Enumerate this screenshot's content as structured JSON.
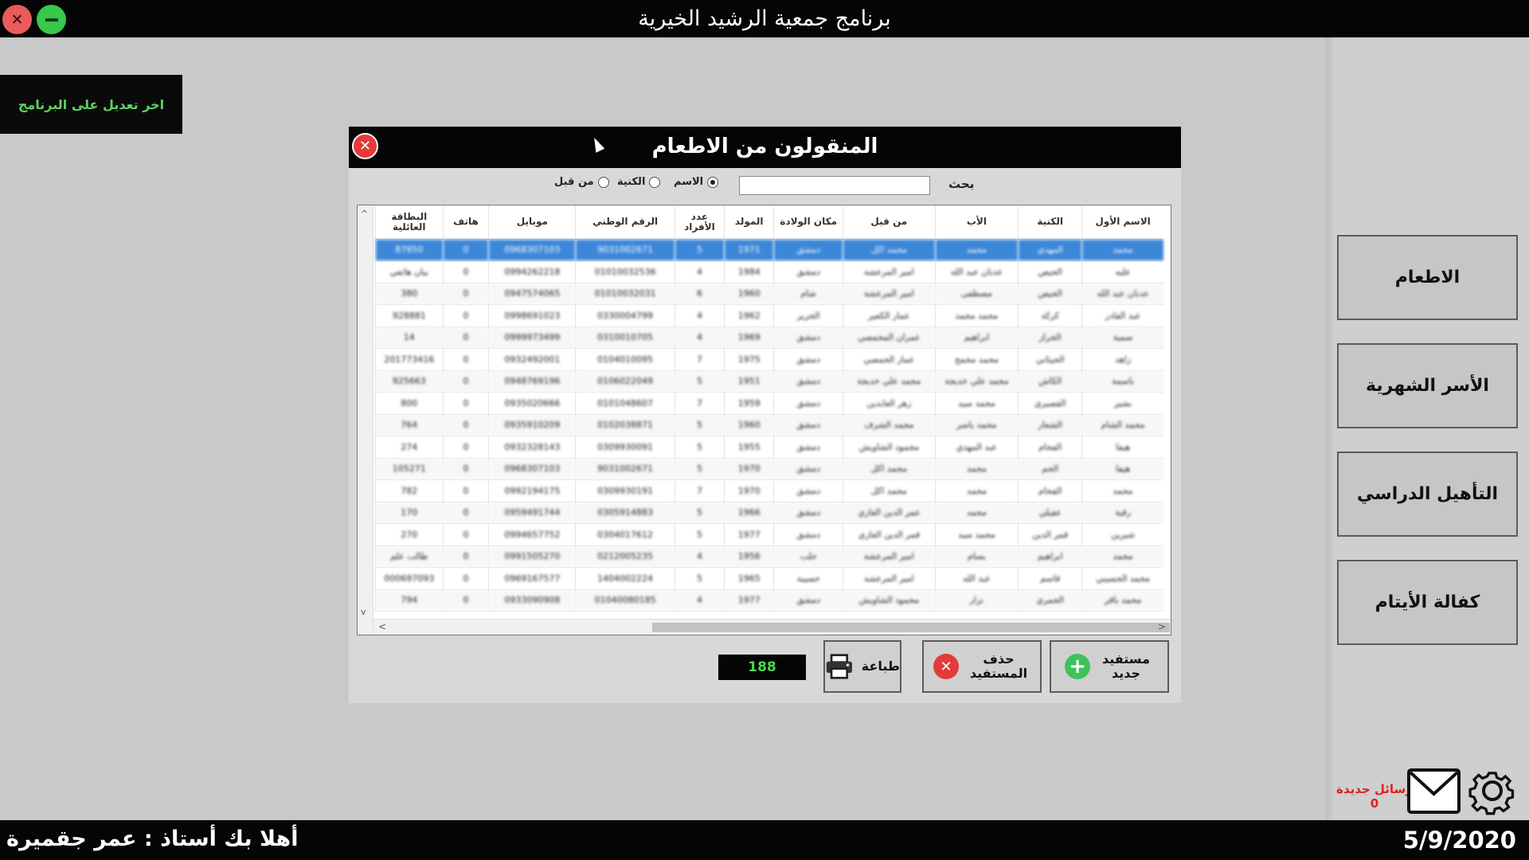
{
  "app": {
    "title": "برنامج جمعية الرشيد الخيرية"
  },
  "last_edit_label": "اخر تعديل على البرنامج",
  "side_buttons": [
    "الاطعام",
    "الأسر الشهرية",
    "التأهيل الدراسي",
    "كفالة الأيتام"
  ],
  "messages": {
    "label": "رسائل جديدة",
    "count": "0"
  },
  "status": {
    "welcome": "أهلا بك أستاذ : عمر جقميرة",
    "date": "5/9/2020"
  },
  "dialog": {
    "title": "المنقولون من الاطعام",
    "search_label": "بحث",
    "search_value": "",
    "radios": [
      {
        "label": "الاسم",
        "selected": true
      },
      {
        "label": "الكنية",
        "selected": false
      },
      {
        "label": "من قبل",
        "selected": false
      }
    ],
    "columns": [
      "الاسم الأول",
      "الكنية",
      "الأب",
      "من قبل",
      "مكان الولادة",
      "المولد",
      "عدد الأفراد",
      "الرقم الوطني",
      "موبايل",
      "هاتف",
      "البطاقة العائلية"
    ],
    "rows": [
      [
        "محمد",
        "المهدي",
        "محمد",
        "محمد اكل",
        "دمشق",
        "1971",
        "5",
        "9031002671",
        "0968307103",
        "0",
        "87850"
      ],
      [
        "عليه",
        "الحيص",
        "عدنان عبد الله",
        "امير المرعشة",
        "دمشق",
        "1984",
        "4",
        "01010032536",
        "0994262218",
        "0",
        "بيان هاتفي"
      ],
      [
        "عدنان عبد الله",
        "الحيص",
        "مصطفى",
        "امير المرعشة",
        "شام",
        "1960",
        "6",
        "01010032031",
        "0947574065",
        "0",
        "380"
      ],
      [
        "عبد القادر",
        "كركة",
        "محمد محمد",
        "عمار الكعير",
        "الحرير",
        "1962",
        "4",
        "0330004799",
        "0998691023",
        "0",
        "928881"
      ],
      [
        "سمية",
        "الخراز",
        "ابراهيم",
        "عمران المحمصي",
        "دمشق",
        "1969",
        "4",
        "0310010705",
        "0999973499",
        "0",
        "14"
      ],
      [
        "زاهد",
        "الحيثاني",
        "محمد محمح",
        "عمار الحمصي",
        "دمشق",
        "1975",
        "7",
        "0104010095",
        "0932492001",
        "0",
        "201773416"
      ],
      [
        "باسمة",
        "الكاش",
        "محمد علي خديجة",
        "محمد علي خديجة",
        "دمشق",
        "1951",
        "5",
        "0106022049",
        "0948769196",
        "0",
        "925663"
      ],
      [
        "بشير",
        "القصيري",
        "محمد سيد",
        "زهر العابدين",
        "دمشق",
        "1959",
        "7",
        "0101048607",
        "0935020666",
        "0",
        "800"
      ],
      [
        "محمد الشام",
        "الشعار",
        "محمد ياسر",
        "محمد الشرف",
        "دمشق",
        "1960",
        "5",
        "0102038871",
        "0935910209",
        "0",
        "764"
      ],
      [
        "هيفا",
        "الفحام",
        "عبد المهدي",
        "محمود الشاويش",
        "دمشق",
        "1955",
        "5",
        "0309930091",
        "0932328143",
        "0",
        "274"
      ],
      [
        "هيفا",
        "الحم",
        "محمد",
        "محمد اكل",
        "دمشق",
        "1970",
        "5",
        "9031002671",
        "0968307103",
        "0",
        "105271"
      ],
      [
        "محمد",
        "الفحام",
        "محمد",
        "محمد اكل",
        "دمشق",
        "1970",
        "7",
        "0309930191",
        "0992194175",
        "0",
        "782"
      ],
      [
        "رقية",
        "عقيلي",
        "محمد",
        "عمر الدين الغازي",
        "دمشق",
        "1966",
        "5",
        "0305914883",
        "0959491744",
        "0",
        "170"
      ],
      [
        "شيرين",
        "قمر الدين",
        "محمد سيد",
        "قمر الدين الغازي",
        "دمشق",
        "1977",
        "5",
        "0304017612",
        "0994657752",
        "0",
        "270"
      ],
      [
        "محمد",
        "ابراهيم",
        "بسام",
        "امير المرعشة",
        "حلب",
        "1956",
        "4",
        "0212005235",
        "0991505270",
        "0",
        "طالب علم"
      ],
      [
        "محمد الحسيني",
        "قاسم",
        "عبد الله",
        "امير المرعشة",
        "حسيبة",
        "1965",
        "5",
        "1404002224",
        "0969167577",
        "0",
        "000697093"
      ],
      [
        "محمد باقر",
        "الحمري",
        "نزار",
        "محمود الشاويش",
        "دمشق",
        "1977",
        "4",
        "01040080185",
        "0933090908",
        "0",
        "794"
      ]
    ],
    "record_count": "188",
    "buttons": {
      "print": "طباعة",
      "delete": "حذف المستفيد",
      "new": "مستفيد جديد"
    }
  }
}
